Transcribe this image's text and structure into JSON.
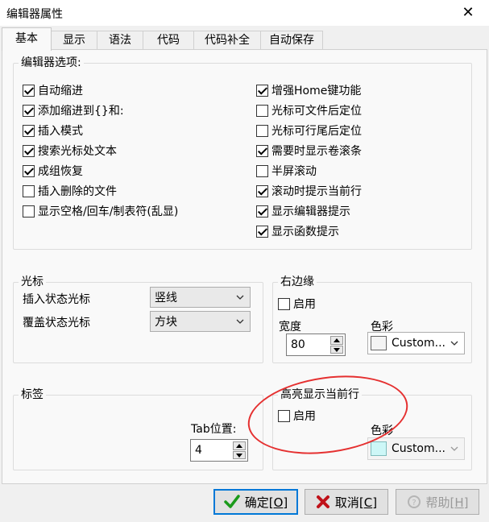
{
  "window": {
    "title": "编辑器属性",
    "close_glyph": "✕"
  },
  "tabs": [
    "基本",
    "显示",
    "语法",
    "代码",
    "代码补全",
    "自动保存"
  ],
  "active_tab": 0,
  "editor_options": {
    "title": "编辑器选项:",
    "left": [
      {
        "label": "自动缩进",
        "checked": true
      },
      {
        "label": "添加缩进到{}和:",
        "checked": true
      },
      {
        "label": "插入模式",
        "checked": true
      },
      {
        "label": "搜索光标处文本",
        "checked": true
      },
      {
        "label": "成组恢复",
        "checked": true
      },
      {
        "label": "插入删除的文件",
        "checked": false
      },
      {
        "label": "显示空格/回车/制表符(乱显)",
        "checked": false
      }
    ],
    "right": [
      {
        "label": "增强Home键功能",
        "checked": true
      },
      {
        "label": "光标可文件后定位",
        "checked": false
      },
      {
        "label": "光标可行尾后定位",
        "checked": false
      },
      {
        "label": "需要时显示卷滚条",
        "checked": true
      },
      {
        "label": "半屏滚动",
        "checked": false
      },
      {
        "label": "滚动时提示当前行",
        "checked": true
      },
      {
        "label": "显示编辑器提示",
        "checked": true
      },
      {
        "label": "显示函数提示",
        "checked": true
      }
    ]
  },
  "cursor": {
    "title": "光标",
    "insert_label": "插入状态光标",
    "insert_value": "竖线",
    "overwrite_label": "覆盖状态光标",
    "overwrite_value": "方块"
  },
  "right_margin": {
    "title": "右边缘",
    "enable_label": "启用",
    "enabled": false,
    "width_label": "宽度",
    "width_value": "80",
    "color_label": "色彩",
    "color_value": "Custom...",
    "swatch_color": "#f4f4f4"
  },
  "labels_group": {
    "title": "标签",
    "tab_pos_label": "Tab位置:",
    "tab_pos_value": "4"
  },
  "highlight_line": {
    "title": "高亮显示当前行",
    "enable_label": "启用",
    "enabled": false,
    "color_label": "色彩",
    "color_value": "Custom...",
    "swatch_color": "#cdf7f7"
  },
  "buttons": {
    "ok": {
      "text": "确定[",
      "key": "O",
      "tail": "]"
    },
    "cancel": {
      "text": "取消[",
      "key": "C",
      "tail": "]"
    },
    "help": {
      "text": "帮助[",
      "key": "H",
      "tail": "]"
    }
  },
  "colors": {
    "annotation_red": "#e53030",
    "ok_green": "#1a9a1a",
    "cancel_red": "#c0121a",
    "focus_blue": "#0078d7"
  }
}
